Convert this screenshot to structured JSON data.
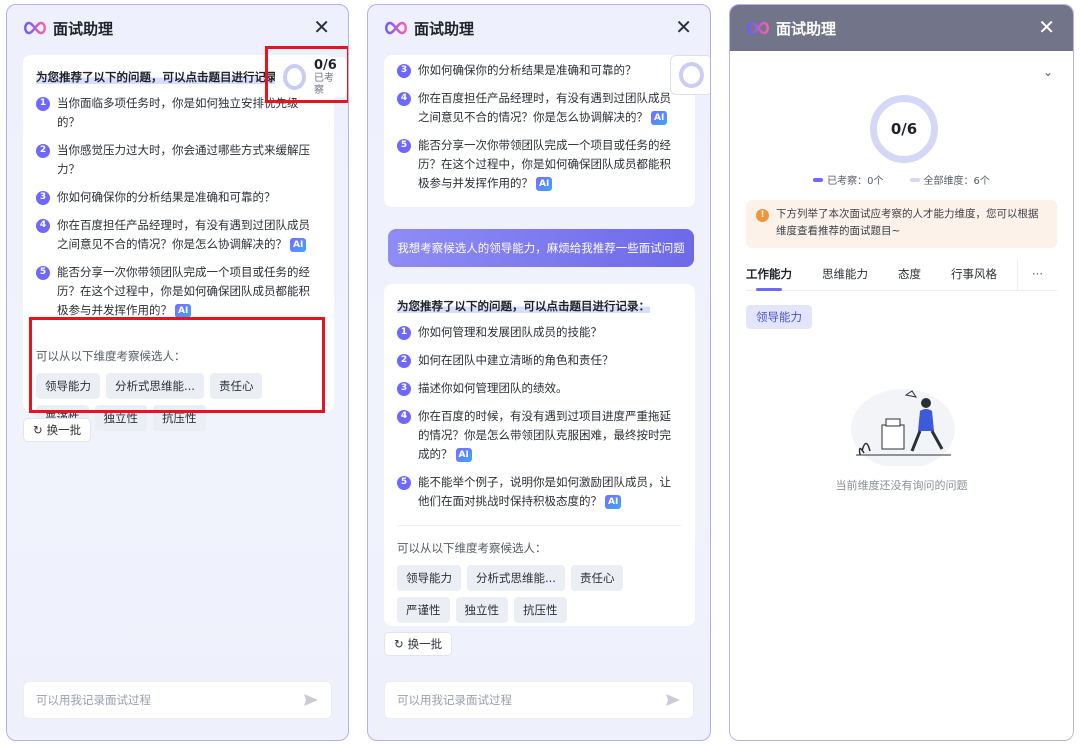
{
  "app": {
    "title": "面试助理"
  },
  "panel1": {
    "progress": {
      "count": "0/6",
      "label": "已考察"
    },
    "card_title": "为您推荐了以下的问题，可以点击题目进行记录：",
    "questions": [
      {
        "n": "1",
        "text": "当你面临多项任务时，你是如何独立安排优先级的？",
        "ai": ""
      },
      {
        "n": "2",
        "text": "当你感觉压力过大时，你会通过哪些方式来缓解压力？",
        "ai": ""
      },
      {
        "n": "3",
        "text": "你如何确保你的分析结果是准确和可靠的？",
        "ai": ""
      },
      {
        "n": "4",
        "text": "你在百度担任产品经理时，有没有遇到过团队成员之间意见不合的情况？你是怎么协调解决的？",
        "ai": "AI"
      },
      {
        "n": "5",
        "text": "能否分享一次你带领团队完成一个项目或任务的经历？在这个过程中，你是如何确保团队成员都能积极参与并发挥作用的？",
        "ai": "AI"
      }
    ],
    "dimension_label": "可以从以下维度考察候选人：",
    "dimensions": [
      "领导能力",
      "分析式思维能...",
      "责任心",
      "严谨性",
      "独立性",
      "抗压性"
    ],
    "refresh_label": "换一批",
    "input_placeholder": "可以用我记录面试过程"
  },
  "panel2": {
    "prev_questions": [
      {
        "n": "3",
        "text": "你如何确保你的分析结果是准确和可靠的？",
        "ai": ""
      },
      {
        "n": "4",
        "text": "你在百度担任产品经理时，有没有遇到过团队成员之间意见不合的情况？你是怎么协调解决的？",
        "ai": "AI"
      },
      {
        "n": "5",
        "text": "能否分享一次你带领团队完成一个项目或任务的经历？在这个过程中，你是如何确保团队成员都能积极参与并发挥作用的？",
        "ai": "AI"
      }
    ],
    "user_message": "我想考察候选人的领导能力，麻烦给我推荐一些面试问题",
    "card_title": "为您推荐了以下的问题，可以点击题目进行记录：",
    "questions": [
      {
        "n": "1",
        "text": "你如何管理和发展团队成员的技能？",
        "ai": ""
      },
      {
        "n": "2",
        "text": "如何在团队中建立清晰的角色和责任？",
        "ai": ""
      },
      {
        "n": "3",
        "text": "描述你如何管理团队的绩效。",
        "ai": ""
      },
      {
        "n": "4",
        "text": "你在百度的时候，有没有遇到过项目进度严重拖延的情况？你是怎么带领团队克服困难，最终按时完成的？",
        "ai": "AI"
      },
      {
        "n": "5",
        "text": "能不能举个例子，说明你是如何激励团队成员，让他们在面对挑战时保持积极态度的？",
        "ai": "AI"
      }
    ],
    "dimension_label": "可以从以下维度考察候选人：",
    "dimensions": [
      "领导能力",
      "分析式思维能...",
      "责任心",
      "严谨性",
      "独立性",
      "抗压性"
    ],
    "refresh_label": "换一批",
    "input_placeholder": "可以用我记录面试过程"
  },
  "panel3": {
    "count": "0/6",
    "legend_checked": "已考察：0个",
    "legend_all": "全部维度：6个",
    "notice": "下方列举了本次面试应考察的人才能力维度，您可以根据维度查看推荐的面试题目~",
    "tabs": [
      "工作能力",
      "思维能力",
      "态度",
      "行事风格"
    ],
    "more": "···",
    "sub_chip": "领导能力",
    "empty_text": "当前维度还没有询问的问题"
  },
  "colors": {
    "accent": "#6f68ff",
    "highlight_box": "#e8141b",
    "header_overlay": "#72748a"
  }
}
